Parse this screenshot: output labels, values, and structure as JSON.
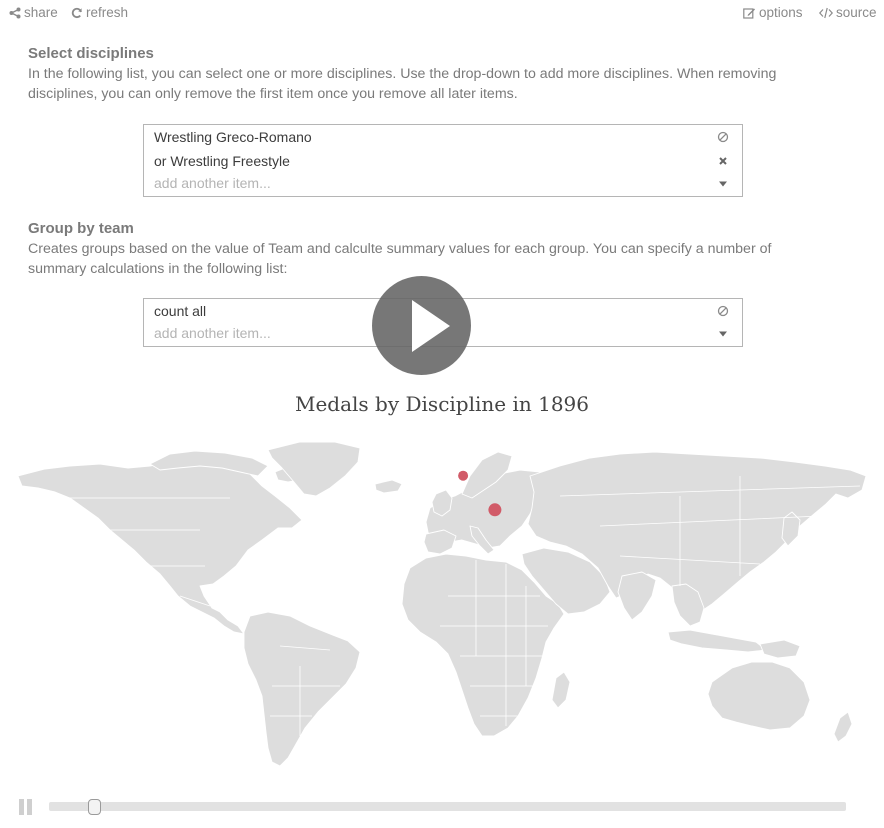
{
  "toolbar": {
    "share_label": "share",
    "refresh_label": "refresh",
    "options_label": "options",
    "source_label": "source"
  },
  "disciplines": {
    "title": "Select disciplines",
    "description": "In the following list, you can select one or more disciplines. Use the drop-down to add more disciplines. When removing disciplines, you can only remove the first item once you remove all later items.",
    "items": [
      "Wrestling Greco-Romano",
      "or Wrestling Freestyle"
    ],
    "placeholder": "add another item..."
  },
  "grouping": {
    "title": "Group by team",
    "description": "Creates groups based on the value of Team and calculte summary values for each group. You can specify a number of summary calculations in the following list:",
    "items": [
      "count all"
    ],
    "placeholder": "add another item..."
  },
  "chart": {
    "title": "Medals by Discipline in 1896",
    "land_color": "#dddddd",
    "marker_color": "#d15b68",
    "markers": [
      {
        "location": "Germany",
        "lon": 9.0,
        "lat": 51.0,
        "size": "small"
      },
      {
        "location": "Greece",
        "lon": 22.5,
        "lat": 39.0,
        "size": "medium"
      }
    ]
  },
  "timeline": {
    "playing": false,
    "position": 0.05
  },
  "colors": {
    "text": "#7a7a7a",
    "border": "#b5b5b5",
    "accent": "#d15b68"
  }
}
